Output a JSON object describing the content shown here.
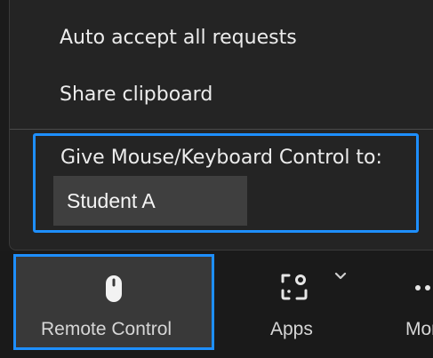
{
  "menu": {
    "auto_accept_label": "Auto accept all requests",
    "share_clipboard_label": "Share clipboard",
    "give_control_label": "Give Mouse/Keyboard Control to:",
    "selected_participant": "Student A"
  },
  "toolbar": {
    "remote_control_label": "Remote Control",
    "apps_label": "Apps",
    "more_label": "More"
  },
  "colors": {
    "highlight": "#1e8fff",
    "menu_bg": "#242424",
    "toolbar_bg": "#1a1a1a"
  },
  "icons": {
    "remote_control": "mouse-icon",
    "apps": "apps-icon",
    "apps_dropdown": "chevron-down-icon",
    "more": "more-dots-icon"
  }
}
